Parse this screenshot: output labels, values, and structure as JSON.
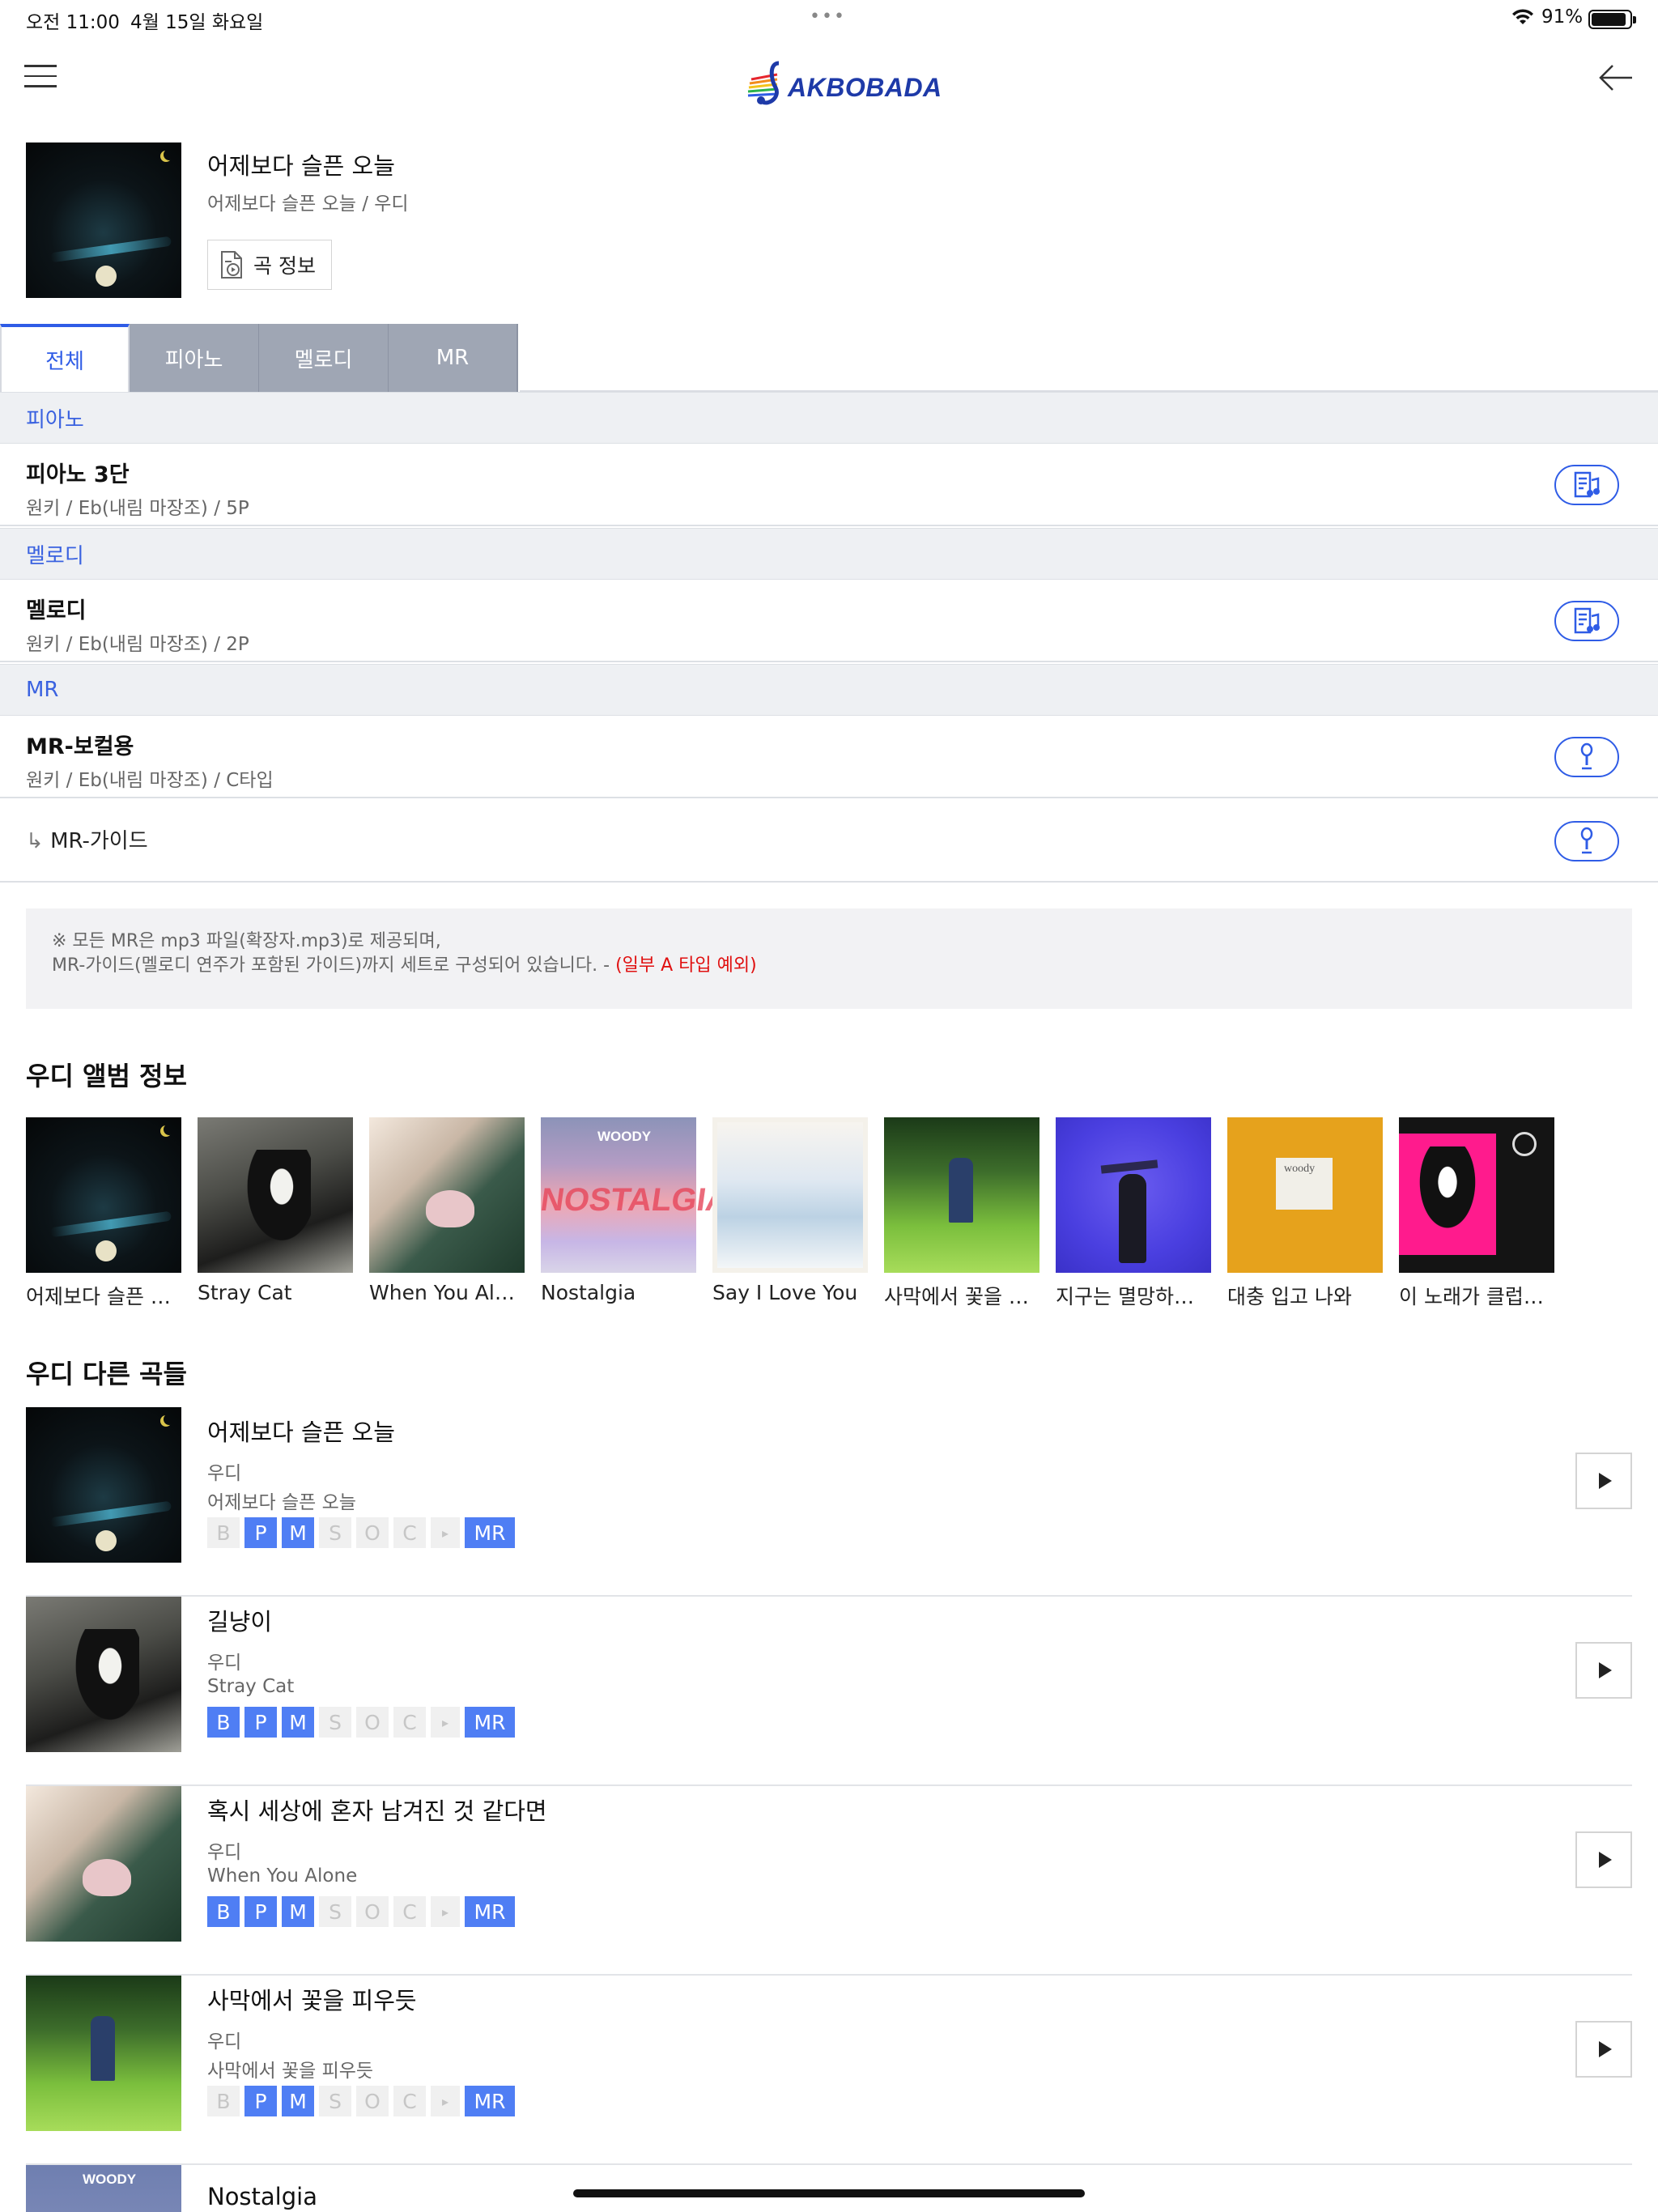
{
  "status_bar": {
    "time": "오전 11:00",
    "date": "4월 15일 화요일",
    "dots": "•••",
    "battery": "91%"
  },
  "header": {
    "logo_text": "AKBOBADA",
    "icons": [
      "hamburger-icon",
      "back-arrow-icon"
    ]
  },
  "song": {
    "title": "어제보다 슬픈 오늘",
    "subtitle": "어제보다 슬픈 오늘 / 우디",
    "info_button": "곡 정보"
  },
  "tabs": [
    {
      "label": "전체",
      "active": true
    },
    {
      "label": "피아노",
      "active": false
    },
    {
      "label": "멜로디",
      "active": false
    },
    {
      "label": "MR",
      "active": false
    }
  ],
  "sections": {
    "piano": {
      "header": "피아노",
      "item_title": "피아노 3단",
      "item_meta": "원키  / Eb(내림 마장조) / 5P"
    },
    "melody": {
      "header": "멜로디",
      "item_title": "멜로디",
      "item_meta": "원키  / Eb(내림 마장조) / 2P"
    },
    "mr": {
      "header": "MR",
      "item_title": "MR-보컬용",
      "item_meta": "원키  / Eb(내림 마장조) / C타입",
      "guide_arrow": "↳",
      "guide_label": "MR-가이드"
    }
  },
  "notice": {
    "line1": "※ 모든 MR은 mp3 파일(확장자.mp3)로 제공되며,",
    "line2": "MR-가이드(멜로디 연주가 포함된 가이드)까지 세트로 구성되어 있습니다. - ",
    "line2_red": "(일부 A 타입 예외)"
  },
  "albums": {
    "title": "우디 앨범 정보",
    "items": [
      {
        "name": "어제보다 슬픈 오늘",
        "art": "c-dark"
      },
      {
        "name": "Stray Cat",
        "art": "c-cat"
      },
      {
        "name": "When You Alone",
        "art": "c-alone"
      },
      {
        "name": "Nostalgia",
        "art": "c-nostalgia",
        "cover_top": "WOODY",
        "cover_mid": "NOSTALGIA"
      },
      {
        "name": "Say I Love You",
        "art": "c-say"
      },
      {
        "name": "사막에서 꽃을 피우듯",
        "art": "c-grass"
      },
      {
        "name": "지구는 멸망하지 않았다",
        "art": "c-violet"
      },
      {
        "name": "대충 입고 나와",
        "art": "c-yellow",
        "cover_tag": "woody"
      },
      {
        "name": "이 노래가 클럽에서 나온다면",
        "art": "c-pink"
      }
    ]
  },
  "other_songs": {
    "title": "우디 다른 곡들",
    "items": [
      {
        "title": "어제보다 슬픈 오늘",
        "artist": "우디",
        "album": "어제보다 슬픈 오늘",
        "art": "c-dark",
        "badges": {
          "B": false,
          "P": true,
          "M": true,
          "S": false,
          "O": false,
          "C": false,
          "arrow": false,
          "MR": true
        }
      },
      {
        "title": "길냥이",
        "artist": "우디",
        "album": "Stray Cat",
        "art": "c-cat",
        "badges": {
          "B": true,
          "P": true,
          "M": true,
          "S": false,
          "O": false,
          "C": false,
          "arrow": false,
          "MR": true
        }
      },
      {
        "title": "혹시 세상에 혼자 남겨진 것 같다면",
        "artist": "우디",
        "album": "When You Alone",
        "art": "c-alone",
        "badges": {
          "B": true,
          "P": true,
          "M": true,
          "S": false,
          "O": false,
          "C": false,
          "arrow": false,
          "MR": true
        }
      },
      {
        "title": "사막에서 꽃을 피우듯",
        "artist": "우디",
        "album": "사막에서 꽃을 피우듯",
        "art": "c-grass",
        "badges": {
          "B": false,
          "P": true,
          "M": true,
          "S": false,
          "O": false,
          "C": false,
          "arrow": false,
          "MR": true
        }
      },
      {
        "title": "Nostalgia",
        "artist": "",
        "album": "",
        "art": "c-woody",
        "cover_top": "WOODY"
      }
    ],
    "badge_labels": [
      "B",
      "P",
      "M",
      "S",
      "O",
      "C",
      "▸",
      "MR"
    ]
  },
  "colors": {
    "accent": "#2f5ce6",
    "badge_on": "#4f7ef4",
    "tab_inactive": "#9fa6b4",
    "notice_red": "#e01010"
  }
}
